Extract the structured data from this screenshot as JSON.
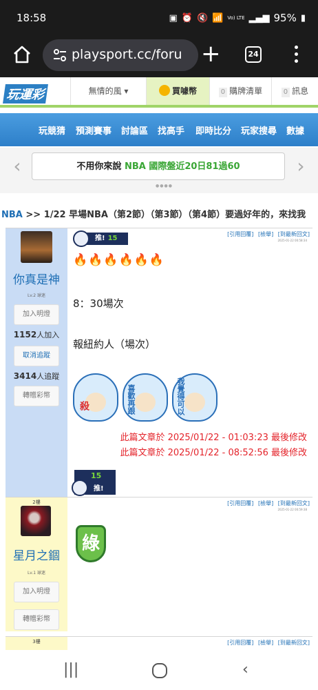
{
  "status_bar": {
    "time": "18:58",
    "signal_text": "Vo) LTE",
    "battery": "95%"
  },
  "browser": {
    "url": "playsport.cc/foru",
    "tab_count": "24"
  },
  "site_header": {
    "logo": "玩運彩",
    "user_tab": "無情的風 ▾",
    "buy_tab": "買噱幣",
    "cart_count": "0",
    "cart_label": "購牌清單",
    "msg_count": "0",
    "msg_label": "訊息"
  },
  "nav": [
    "玩競猜",
    "預測賽事",
    "討論區",
    "找高手",
    "即時比分",
    "玩家搜尋",
    "數據"
  ],
  "announcement": {
    "prefix": "不用你來說 ",
    "highlight": "NBA 國際盤近20日81過60"
  },
  "breadcrumb": {
    "category": "NBA",
    "separator": " >> ",
    "title": "1/22 早場NBA（第2節）（第3節）（第4節）要過好年的，來找我"
  },
  "post1": {
    "username": "你真是神",
    "level": "Lv.2 球迷",
    "add_light_btn": "加入明燈",
    "followers_count": "1152",
    "followers_label": "人加入",
    "unfollow_btn": "取消追蹤",
    "tracking_count": "3414",
    "tracking_label": "人追蹤",
    "gift_btn": "轉贈彩幣",
    "links": [
      "[引用回覆]",
      "[檢舉]",
      "[到最新回文]"
    ],
    "timestamp": "2025-01-22 00:58:34",
    "push_label": "推!",
    "push_count": "15",
    "fires": "🔥🔥🔥🔥🔥🔥",
    "line1": "8：30場次",
    "line2": "報紐約人（場次）",
    "sticker_words": [
      "殺",
      "喜歡再跟",
      "我覺得可以"
    ],
    "edit1": "此篇文章於 2025/01/22 - 01:03:23 最後修改",
    "edit2": "此篇文章於 2025/01/22 - 08:52:56 最後修改",
    "push2_count": "15",
    "push2_label": "推!"
  },
  "post2": {
    "floor": "2樓",
    "username": "星月之錮",
    "level": "Lv.1 球迷",
    "add_light_btn": "加入明燈",
    "gift_btn": "轉贈彩幣",
    "links": [
      "[引用回覆]",
      "[檢舉]",
      "[到最新回文]"
    ],
    "timestamp": "2025-01-22 00:59:38",
    "sticker": "綠"
  },
  "post3": {
    "floor": "3樓",
    "links": [
      "[引用回覆]",
      "[檢舉]",
      "[到最新回文]"
    ]
  },
  "colors": {
    "link_blue": "#1f6fb5",
    "edit_red": "#e4242b",
    "nav_blue": "#2d7fc9",
    "accent_green": "#a0d468"
  }
}
